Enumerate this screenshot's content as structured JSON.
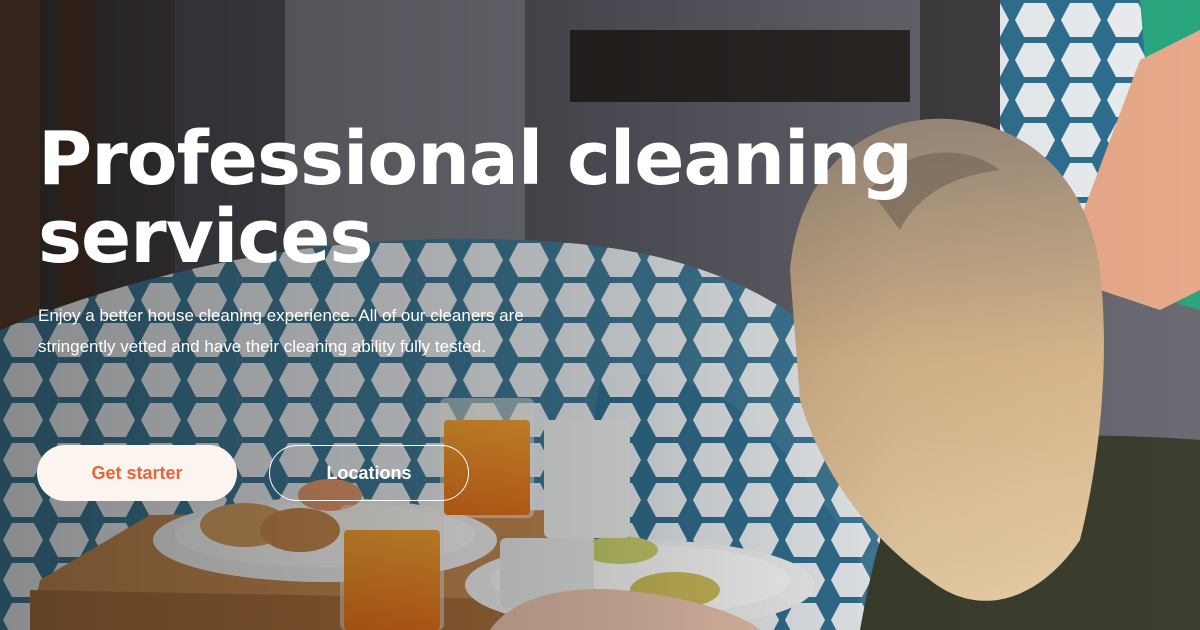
{
  "hero": {
    "title_line1": "Professional cleaning",
    "title_line2": "services",
    "description": "Enjoy a better house cleaning experience. All of our cleaners are stringently vetted and have their cleaning ability fully tested.",
    "background_image": "photo-woman-breakfast-in-bed",
    "primary_button": "Get starter",
    "secondary_button": "Locations"
  },
  "colors": {
    "accent": "#e8643a",
    "primary_button_bg": "#fbf4ef",
    "text": "#ffffff"
  }
}
